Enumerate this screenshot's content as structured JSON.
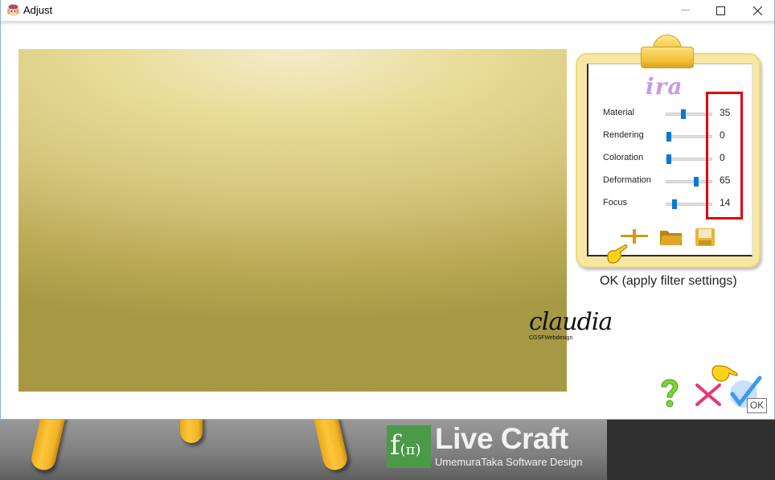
{
  "window": {
    "title": "Adjust",
    "controls": {
      "minimize": "—",
      "maximize": "☐",
      "close": "✕"
    }
  },
  "preview": {
    "signature_script": "claudia",
    "signature_subtext": "CGSFWebdesign"
  },
  "panel": {
    "logo": "ira",
    "parameters": [
      {
        "label": "Material",
        "value": "35",
        "max": 100
      },
      {
        "label": "Rendering",
        "value": "0",
        "max": 100
      },
      {
        "label": "Coloration",
        "value": "0",
        "max": 100
      },
      {
        "label": "Deformation",
        "value": "65",
        "max": 100
      },
      {
        "label": "Focus",
        "value": "14",
        "max": 100
      }
    ],
    "highlight_color": "#e3000f",
    "slider_color": "#0a78d7",
    "toolbar": [
      "add-preset-icon",
      "open-folder-icon",
      "save-disk-icon"
    ]
  },
  "status_caption": "OK (apply filter settings)",
  "actions": {
    "help": "?",
    "cancel": "✕",
    "ok": "✓",
    "ok_tooltip": "OK"
  },
  "branding": {
    "logo_mark": "f",
    "logo_mark_sub": "(π)",
    "title": "Live Craft",
    "subtitle": "UmemuraTaka Software Design",
    "accent": "#4a9a48"
  }
}
